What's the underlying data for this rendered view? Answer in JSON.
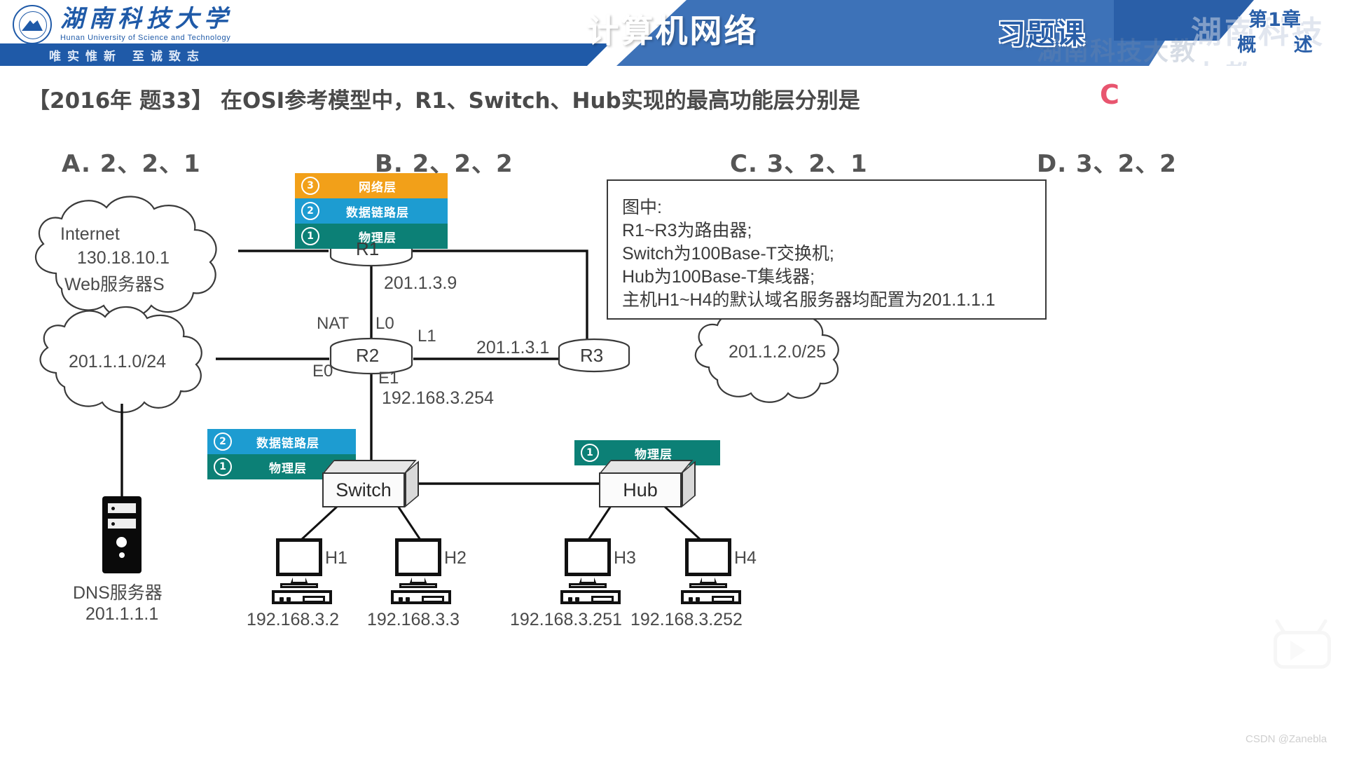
{
  "header": {
    "title": "计算机网络",
    "university_cn": "湖南科技大学",
    "university_en": "Hunan University of Science and Technology",
    "motto": "唯实惟新     至诚致志",
    "exercise_label": "习题课",
    "chapter": "第1章",
    "chapter_title": "概  述",
    "watermark": "湖南科技大教"
  },
  "question": {
    "text": "【2016年 题33】 在OSI参考模型中，R1、Switch、Hub实现的最高功能层分别是",
    "answer": "C",
    "answer_color": "#e8556f",
    "options": [
      {
        "key": "A",
        "label": "A. 2、2、1"
      },
      {
        "key": "B",
        "label": "B. 2、2、2"
      },
      {
        "key": "C",
        "label": "C. 3、2、1"
      },
      {
        "key": "D",
        "label": "D. 3、2、2"
      }
    ]
  },
  "layer_colors": {
    "network": "#f2a019",
    "datalink": "#1d9cd1",
    "physical": "#0c8076"
  },
  "stacks": {
    "r1": [
      {
        "num": "3",
        "name": "网络层"
      },
      {
        "num": "2",
        "name": "数据链路层"
      },
      {
        "num": "1",
        "name": "物理层"
      }
    ],
    "switch": [
      {
        "num": "2",
        "name": "数据链路层"
      },
      {
        "num": "1",
        "name": "物理层"
      }
    ],
    "hub": [
      {
        "num": "1",
        "name": "物理层"
      }
    ]
  },
  "info_box": {
    "lines": [
      "图中:",
      "R1~R3为路由器;",
      "Switch为100Base-T交换机;",
      "Hub为100Base-T集线器;",
      "主机H1~H4的默认域名服务器均配置为201.1.1.1"
    ]
  },
  "diagram": {
    "clouds": [
      {
        "id": "internet",
        "lines": [
          "Internet",
          "130.18.10.1",
          "Web服务器S"
        ]
      },
      {
        "id": "lan201",
        "lines": [
          "201.1.1.0/24"
        ]
      },
      {
        "id": "lan2012",
        "lines": [
          "201.1.2.0/25"
        ]
      }
    ],
    "routers": [
      {
        "id": "r1",
        "label": "R1"
      },
      {
        "id": "r2",
        "label": "R2"
      },
      {
        "id": "r3",
        "label": "R3"
      }
    ],
    "router_ips": {
      "r1_down": "201.1.3.9",
      "r3_left": "201.1.3.1",
      "r2_e1": "192.168.3.254"
    },
    "interfaces": {
      "nat": "NAT",
      "l0": "L0",
      "l1": "L1",
      "e0": "E0",
      "e1": "E1"
    },
    "devices": [
      {
        "id": "switch",
        "label": "Switch"
      },
      {
        "id": "hub",
        "label": "Hub"
      }
    ],
    "dns_server": {
      "name": "DNS服务器",
      "ip": "201.1.1.1"
    },
    "hosts": [
      {
        "name": "H1",
        "ip": "192.168.3.2"
      },
      {
        "name": "H2",
        "ip": "192.168.3.3"
      },
      {
        "name": "H3",
        "ip": "192.168.3.251"
      },
      {
        "name": "H4",
        "ip": "192.168.3.252"
      }
    ]
  },
  "footer": {
    "watermark": "CSDN @Zanebla"
  }
}
